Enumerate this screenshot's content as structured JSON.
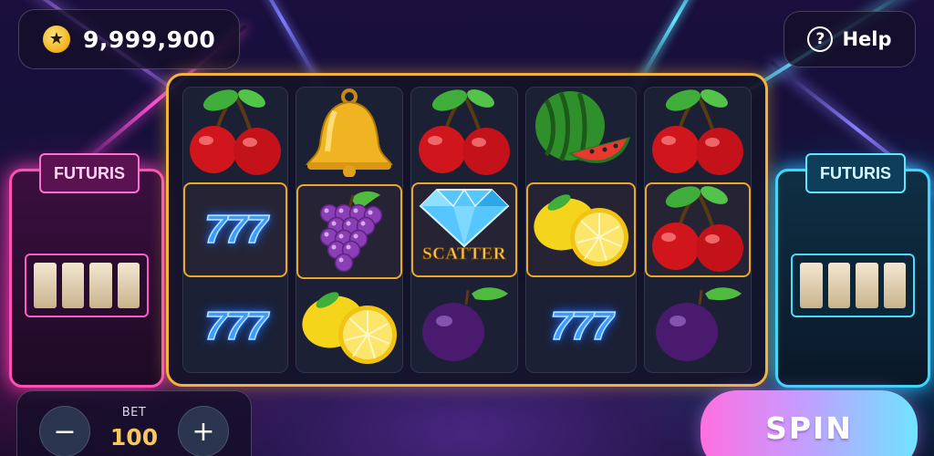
{
  "header": {
    "balance": "9,999,900",
    "balance_icon": "star-coin-icon",
    "help_label": "Help",
    "help_icon": "question-circle-icon"
  },
  "background": {
    "machine_sign_left": "FUTURIS",
    "machine_sign_right": "FUTURIS"
  },
  "reels": [
    [
      "cherry",
      "seven",
      "seven"
    ],
    [
      "bell",
      "grapes",
      "lemon"
    ],
    [
      "cherry",
      "diamond-scatter",
      "plum"
    ],
    [
      "watermelon",
      "lemon",
      "seven"
    ],
    [
      "cherry",
      "cherry",
      "plum"
    ]
  ],
  "highlighted_row": 2,
  "symbols": {
    "seven_text": "777",
    "scatter_text": "SCATTER"
  },
  "controls": {
    "bet_label": "BET",
    "bet_value": "100",
    "minus_symbol": "−",
    "plus_symbol": "+",
    "spin_label": "SPIN"
  },
  "colors": {
    "frame_gold": "#f2b33a",
    "spin_gradient_start": "#ff6fe0",
    "spin_gradient_end": "#6fe3ff"
  }
}
